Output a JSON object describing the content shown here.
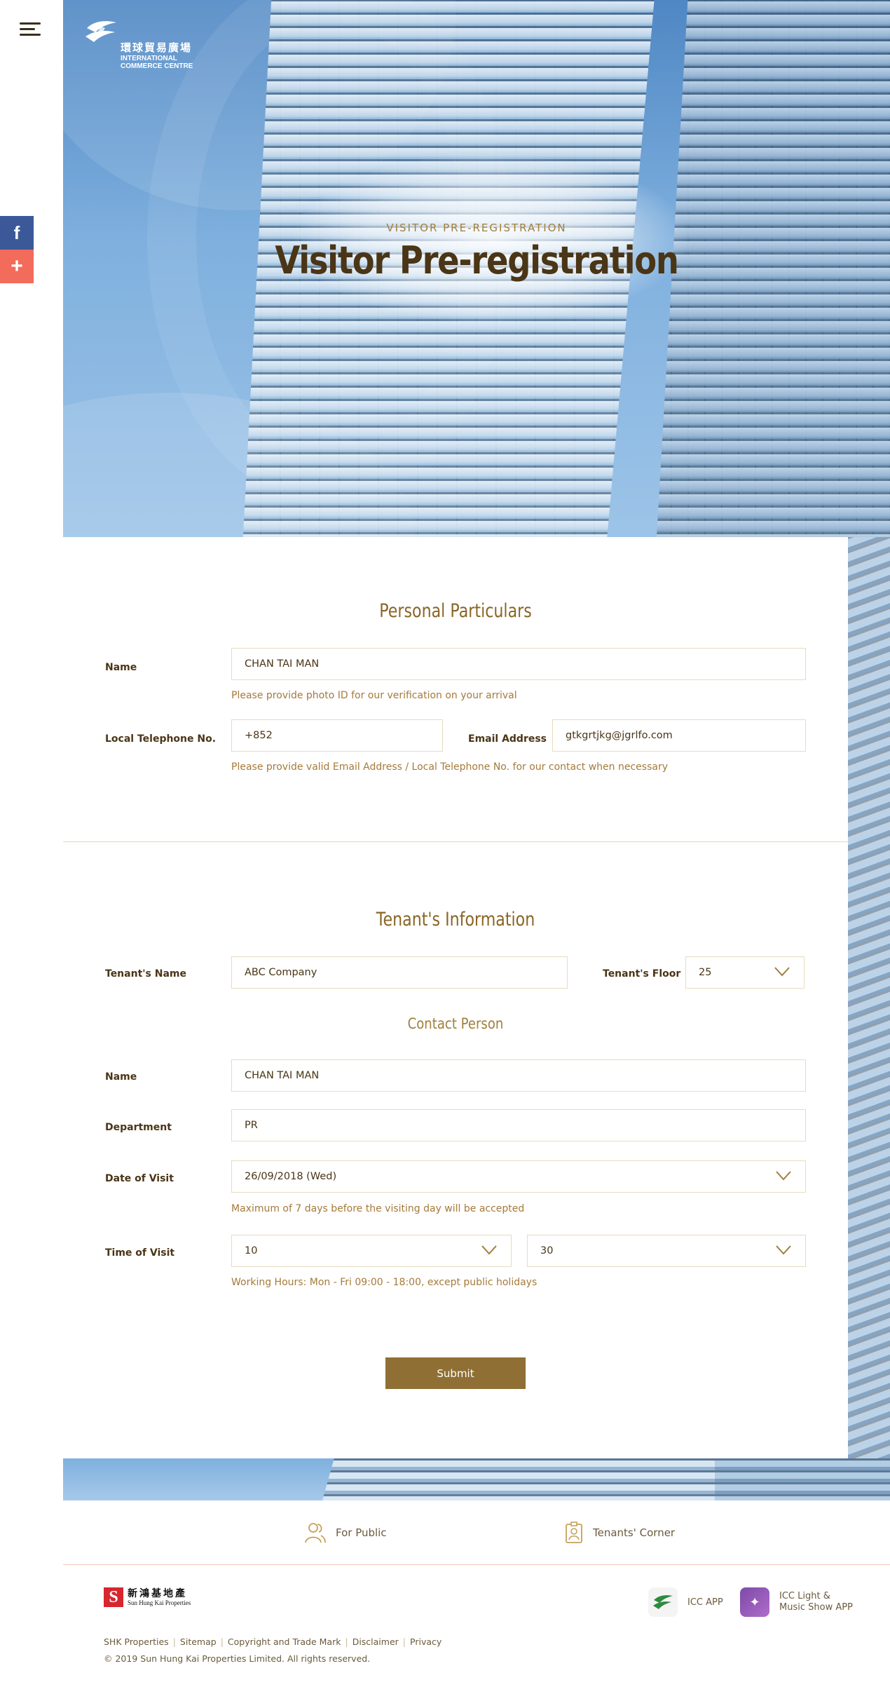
{
  "hero": {
    "logo": {
      "cn": "環球貿易廣場",
      "en": "INTERNATIONAL COMMERCE CENTRE"
    },
    "eyebrow": "VISITOR PRE-REGISTRATION",
    "title": "Visitor Pre-registration"
  },
  "share": {
    "facebook_icon": "f",
    "plus_icon": "+"
  },
  "personal": {
    "title": "Personal Particulars",
    "name_label": "Name",
    "name_value": "CHAN TAI MAN",
    "name_hint": "Please provide photo ID for our verification on your arrival",
    "phone_label": "Local Telephone No.",
    "phone_value": "+852",
    "email_label": "Email Address",
    "email_value": "gtkgrtjkg@jgrlfo.com",
    "contact_hint": "Please provide valid Email Address / Local Telephone No. for our contact when necessary"
  },
  "tenant": {
    "title": "Tenant's Information",
    "name_label": "Tenant's Name",
    "name_value": "ABC Company",
    "floor_label": "Tenant's Floor",
    "floor_value": "25",
    "contact_title": "Contact Person",
    "contact_name_label": "Name",
    "contact_name_value": "CHAN TAI MAN",
    "department_label": "Department",
    "department_value": "PR",
    "date_label": "Date of Visit",
    "date_value": "26/09/2018 (Wed)",
    "date_hint": "Maximum of 7 days before the visiting day will be accepted",
    "time_label": "Time of Visit",
    "time_hour": "10",
    "time_minute": "30",
    "time_hint": "Working Hours: Mon - Fri 09:00 - 18:00, except public holidays"
  },
  "submit_label": "Submit",
  "footer": {
    "for_public": "For Public",
    "tenants_corner": "Tenants' Corner",
    "shk_cn": "新鴻基地產",
    "shk_en": "Sun Hung Kai Properties",
    "icc_app": "ICC APP",
    "light_show_app": "ICC Light & Music Show APP",
    "links": [
      "SHK Properties",
      "Sitemap",
      "Copyright and Trade Mark",
      "Disclaimer",
      "Privacy"
    ],
    "copyright": "© 2019 Sun Hung Kai Properties Limited. All rights reserved."
  },
  "colors": {
    "accent_gold": "#8f6f33",
    "title_brown": "#4a3516",
    "hint_gold": "#a57a3a",
    "facebook": "#3b5998",
    "plus": "#f26b5b"
  }
}
